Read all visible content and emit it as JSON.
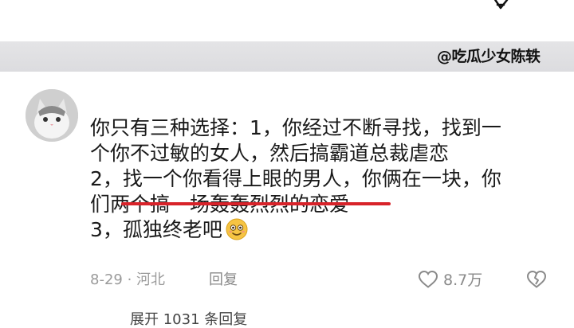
{
  "watermark": {
    "text": "@吃瓜少女陈轶"
  },
  "comment": {
    "lines": [
      "你只有三种选择：1，你经过不断寻找，找到一",
      "个你不过敏的女人，然后搞霸道总裁虐恋",
      "2，找一个你看得上眼的男人，你俩在一块，你",
      "们两个搞一场轰轰烈烈的恋爱",
      "3，孤独终老吧"
    ],
    "emoji": "smiling-face-emoji",
    "highlight_color": "#d8232a"
  },
  "meta": {
    "date_location": "8-29 · 河北",
    "reply_label": "回复",
    "like_count": "8.7万",
    "like_icon": "heart-icon",
    "dislike_icon": "broken-heart-icon"
  },
  "next_comment_fragment": "展开 1031 条回复"
}
